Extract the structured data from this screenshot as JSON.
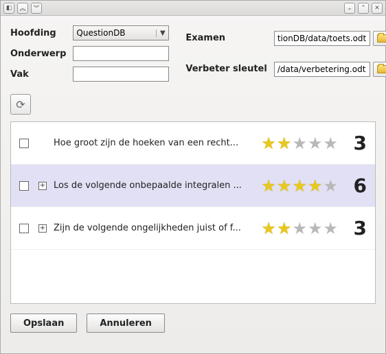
{
  "form": {
    "hoofding_label": "Hoofding",
    "hoofding_value": "QuestionDB",
    "onderwerp_label": "Onderwerp",
    "onderwerp_value": "",
    "vak_label": "Vak",
    "vak_value": "",
    "examen_label": "Examen",
    "examen_value": "tionDB/data/toets.odt",
    "verbeter_label": "Verbeter sleutel",
    "verbeter_value": "/data/verbetering.odt"
  },
  "rows": [
    {
      "text": "Hoe groot zijn de hoeken van een recht...",
      "rating": 2,
      "count": "3",
      "expandable": false,
      "selected": false
    },
    {
      "text": "Los de volgende onbepaalde integralen ...",
      "rating": 4,
      "count": "6",
      "expandable": true,
      "selected": true
    },
    {
      "text": "Zijn de volgende ongelijkheden juist of f...",
      "rating": 2,
      "count": "3",
      "expandable": true,
      "selected": false
    }
  ],
  "footer": {
    "save": "Opslaan",
    "cancel": "Annuleren"
  }
}
